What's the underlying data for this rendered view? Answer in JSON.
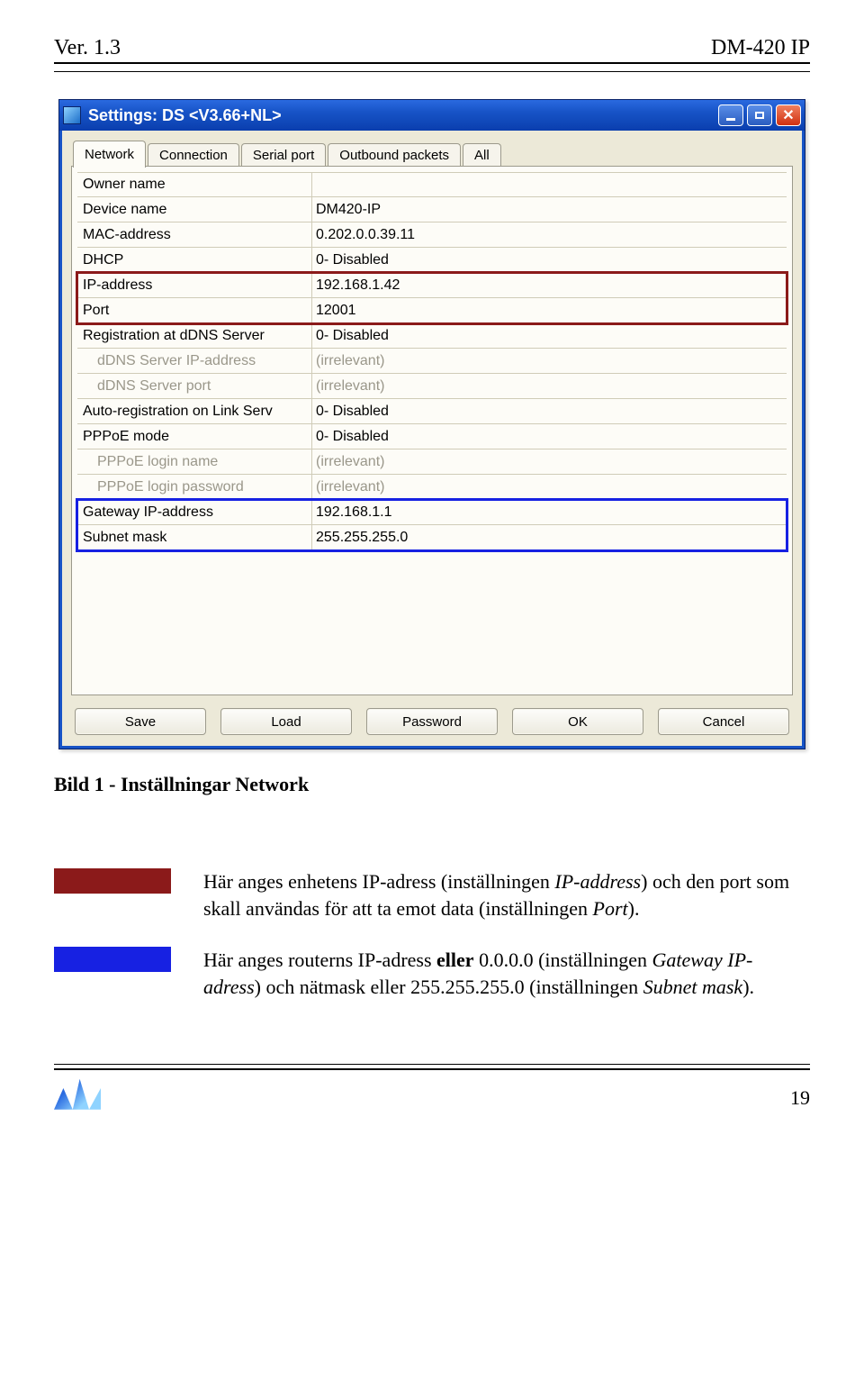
{
  "doc": {
    "version_label": "Ver. 1.3",
    "model_label": "DM-420 IP",
    "page_number": "19"
  },
  "window": {
    "title": "Settings: DS <V3.66+NL>",
    "tabs": [
      "Network",
      "Connection",
      "Serial port",
      "Outbound packets",
      "All"
    ],
    "active_tab_index": 0,
    "rows": [
      {
        "label": "Owner name",
        "value": "",
        "dim": false
      },
      {
        "label": "Device name",
        "value": "DM420-IP",
        "dim": false
      },
      {
        "label": "MAC-address",
        "value": "0.202.0.0.39.11",
        "dim": false
      },
      {
        "label": "DHCP",
        "value": "0- Disabled",
        "dim": false
      },
      {
        "label": "IP-address",
        "value": "192.168.1.42",
        "dim": false
      },
      {
        "label": "Port",
        "value": "12001",
        "dim": false
      },
      {
        "label": "Registration at dDNS Server",
        "value": "0- Disabled",
        "dim": false
      },
      {
        "label": "dDNS Server IP-address",
        "value": "(irrelevant)",
        "dim": true
      },
      {
        "label": "dDNS Server port",
        "value": "(irrelevant)",
        "dim": true
      },
      {
        "label": "Auto-registration on Link Serv",
        "value": "0- Disabled",
        "dim": false
      },
      {
        "label": "PPPoE mode",
        "value": "0- Disabled",
        "dim": false
      },
      {
        "label": "PPPoE login name",
        "value": "(irrelevant)",
        "dim": true
      },
      {
        "label": "PPPoE login password",
        "value": "(irrelevant)",
        "dim": true
      },
      {
        "label": "Gateway IP-address",
        "value": "192.168.1.1",
        "dim": false
      },
      {
        "label": "Subnet mask",
        "value": "255.255.255.0",
        "dim": false
      }
    ],
    "buttons": [
      "Save",
      "Load",
      "Password",
      "OK",
      "Cancel"
    ],
    "highlights": {
      "red_rows": [
        4,
        5
      ],
      "blue_rows": [
        13,
        14
      ]
    }
  },
  "caption": "Bild 1 - Inställningar Network",
  "legend": {
    "red": {
      "prefix": "Här anges enhetens IP-adress (inställningen ",
      "italic1": "IP-address",
      "mid": ")  och den port som skall användas för att ta emot data (inställningen ",
      "italic2": "Port",
      "suffix": ")."
    },
    "blue": {
      "line1_prefix": "Här anges routerns IP-adress ",
      "line1_bold": "eller",
      "line1_mid": " 0.0.0.0 (inställningen ",
      "line1_italic": "Gateway IP-adress",
      "line1_suffix": ") och nätmask eller 255.255.255.0 (inställningen ",
      "line2_italic": "Subnet mask",
      "line2_suffix": ")."
    }
  }
}
